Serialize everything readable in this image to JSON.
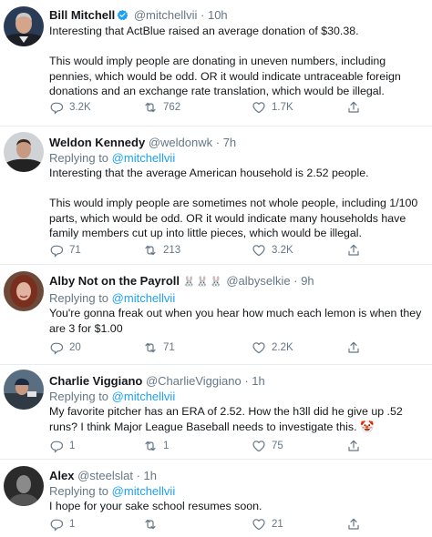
{
  "tweets": [
    {
      "name": "Bill Mitchell",
      "verified": true,
      "handle": "@mitchellvii",
      "time": "10h",
      "replying_prefix": "",
      "replying_to": "",
      "text": "Interesting that ActBlue raised an average donation of $30.38.\n\nThis would imply people are donating in uneven numbers, including pennies, which would be odd. OR it would indicate untraceable foreign donations and an exchange rate translation, which would be illegal.",
      "replies": "3.2K",
      "retweets": "762",
      "likes": "1.7K"
    },
    {
      "name": "Weldon Kennedy",
      "verified": false,
      "handle": "@weldonwk",
      "time": "7h",
      "replying_prefix": "Replying to",
      "replying_to": "@mitchellvii",
      "text": "Interesting that the average American household is 2.52 people.\n\nThis would imply people are sometimes not whole people, including 1/100 parts, which would be odd. OR it would indicate many households have family members cut up into little pieces, which would be illegal.",
      "replies": "71",
      "retweets": "213",
      "likes": "3.2K"
    },
    {
      "name": "Alby Not on the Payroll",
      "name_emoji": "🐰🐰🐰",
      "verified": false,
      "handle": "@albyselkie",
      "time": "9h",
      "replying_prefix": "Replying to",
      "replying_to": "@mitchellvii",
      "text": "You're gonna freak out when you hear how much each lemon is when they are 3 for $1.00",
      "replies": "20",
      "retweets": "71",
      "likes": "2.2K"
    },
    {
      "name": "Charlie Viggiano",
      "verified": false,
      "handle": "@CharlieViggiano",
      "time": "1h",
      "replying_prefix": "Replying to",
      "replying_to": "@mitchellvii",
      "text": "My favorite pitcher has an ERA of 2.52. How the h3ll did he give up .52 runs? I think Major League Baseball needs to investigate this.",
      "text_emoji": "🤡",
      "replies": "1",
      "retweets": "1",
      "likes": "75"
    },
    {
      "name": "Alex",
      "verified": false,
      "handle": "@steelslat",
      "time": "1h",
      "replying_prefix": "Replying to",
      "replying_to": "@mitchellvii",
      "text": "I hope for your sake school resumes soon.",
      "replies": "1",
      "retweets": "",
      "likes": "21"
    }
  ],
  "colors": {
    "link": "#1da1f2",
    "secondary": "#657786",
    "divider": "#e6ecf0",
    "verified": "#1da1f2"
  },
  "icons": [
    "reply-icon",
    "retweet-icon",
    "like-icon",
    "share-icon",
    "verified-badge-icon"
  ]
}
